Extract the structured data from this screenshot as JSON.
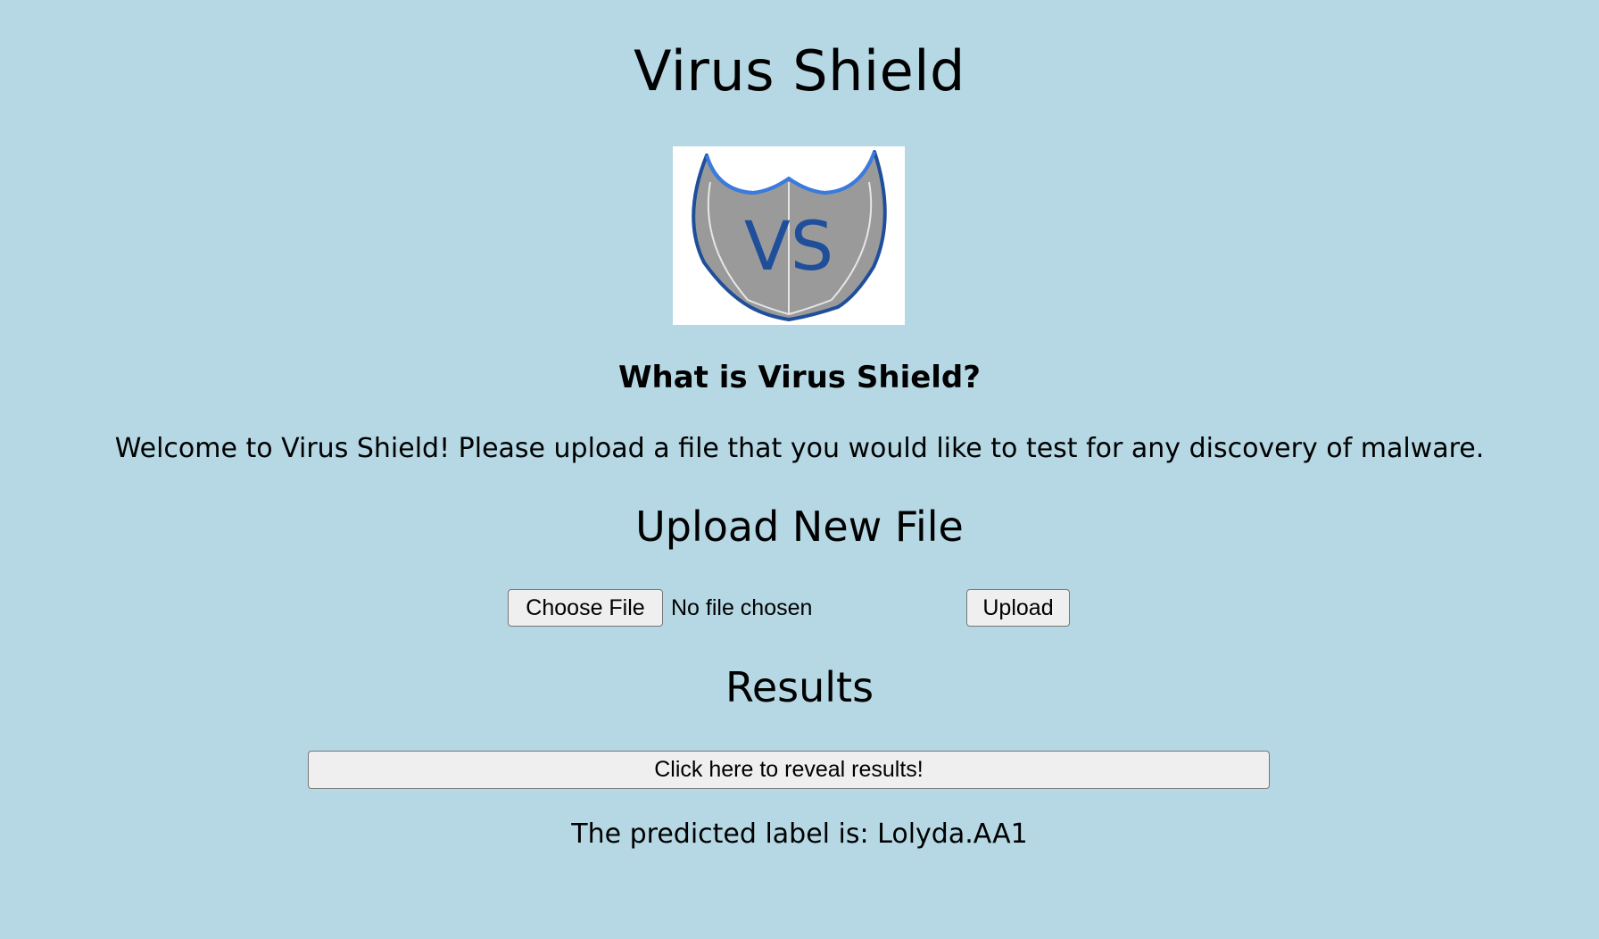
{
  "header": {
    "title": "Virus Shield"
  },
  "logo": {
    "icon": "virus-shield-logo",
    "text": "VS",
    "colors": {
      "shield_fill": "#9a9a9a",
      "shield_outline": "#1f4f9a",
      "shield_highlight": "#3a7be0",
      "text": "#1f4f9a"
    }
  },
  "about": {
    "heading": "What is Virus Shield?",
    "description": "Welcome to Virus Shield! Please upload a file that you would like to test for any discovery of malware."
  },
  "upload": {
    "heading": "Upload New File",
    "choose_label": "Choose File",
    "status": "No file chosen",
    "upload_label": "Upload"
  },
  "results": {
    "heading": "Results",
    "reveal_label": "Click here to reveal results!",
    "prediction": "The predicted label is: Lolyda.AA1"
  },
  "colors": {
    "background": "#b5d8e4",
    "button_bg": "#efefef"
  }
}
